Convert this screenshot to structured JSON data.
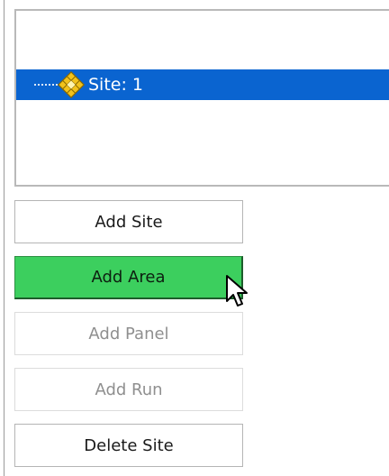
{
  "tree": {
    "items": [
      {
        "label": "Site: 1",
        "icon": "site-diamond-icon",
        "selected": true
      }
    ],
    "selection_color": "#0a64d0"
  },
  "buttons": {
    "add_site": {
      "label": "Add Site",
      "enabled": true
    },
    "add_area": {
      "label": "Add Area",
      "enabled": true,
      "highlight_color": "#3ccf5e"
    },
    "add_panel": {
      "label": "Add Panel",
      "enabled": false
    },
    "add_run": {
      "label": "Add Run",
      "enabled": false
    },
    "delete_site": {
      "label": "Delete Site",
      "enabled": true
    }
  },
  "icons": {
    "tree_node": "site-diamond-icon",
    "cursor": "mouse-pointer-icon"
  }
}
